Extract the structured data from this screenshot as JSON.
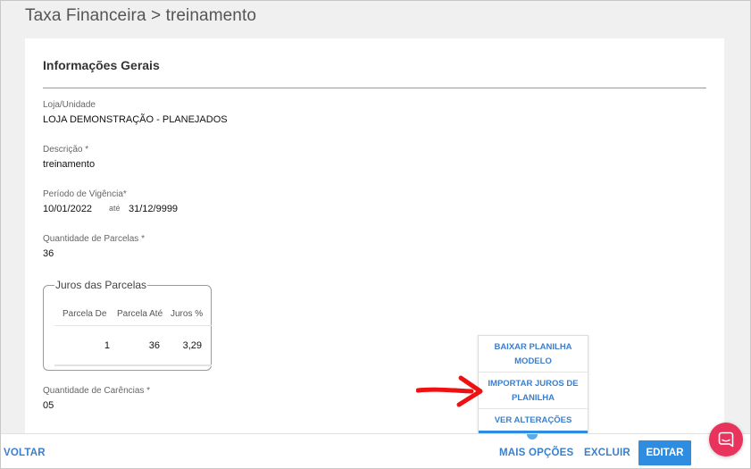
{
  "header": {
    "title": "Taxa Financeira > treinamento"
  },
  "section": {
    "title": "Informações Gerais"
  },
  "fields": {
    "loja": {
      "label": "Loja/Unidade",
      "value": "LOJA DEMONSTRAÇÃO - PLANEJADOS"
    },
    "descricao": {
      "label": "Descrição *",
      "value": "treinamento"
    },
    "vigencia": {
      "label": "Período de Vigência*",
      "from": "10/01/2022",
      "sep": "até",
      "to": "31/12/9999"
    },
    "parcelas": {
      "label": "Quantidade de Parcelas *",
      "value": "36"
    },
    "carencias": {
      "label": "Quantidade de Carências *",
      "value": "05"
    }
  },
  "juros": {
    "legend": "Juros das Parcelas",
    "columns": [
      "Parcela De",
      "Parcela Até",
      "Juros %"
    ],
    "rows": [
      [
        "1",
        "36",
        "3,29"
      ]
    ]
  },
  "dropdown": {
    "items": [
      {
        "line1": "BAIXAR PLANILHA",
        "line2": "MODELO"
      },
      {
        "line1": "IMPORTAR JUROS DE",
        "line2": "PLANILHA"
      },
      {
        "line1": "VER ALTERAÇÕES"
      }
    ]
  },
  "footer": {
    "voltar": "VOLTAR",
    "mais_opcoes": "MAIS OPÇÕES",
    "excluir": "EXCLUIR",
    "editar": "EDITAR"
  },
  "colors": {
    "accent": "#2e8de0",
    "link": "#3b7fcc",
    "chat": "#e8345c",
    "arrow": "#ee1111"
  },
  "icons": {
    "chat": "chat-bubble-icon",
    "annotation": "red-arrow-icon"
  }
}
